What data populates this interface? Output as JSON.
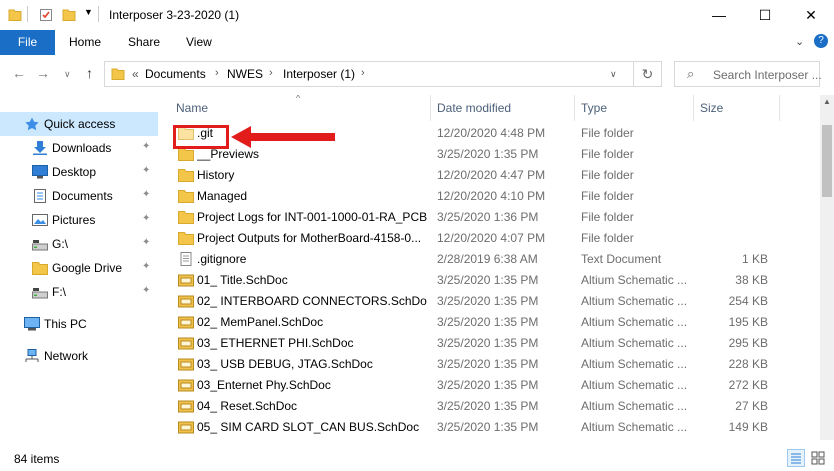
{
  "window": {
    "title": "Interposer 3-23-2020 (1)",
    "controls": {
      "minimize": "—",
      "maximize": "☐",
      "close": "✕"
    }
  },
  "ribbon": {
    "tabs": [
      "File",
      "Home",
      "Share",
      "View"
    ],
    "expand": "⌄",
    "help": "?"
  },
  "address": {
    "overflow": "«",
    "crumbs": [
      "Documents",
      "NWES",
      "Interposer (1)"
    ],
    "separator": "›",
    "refresh": "↻"
  },
  "search": {
    "placeholder": "Search Interposer ..."
  },
  "nav": {
    "items": [
      {
        "label": "Quick access",
        "icon": "star-icon",
        "pinned": false,
        "selected": true
      },
      {
        "label": "Downloads",
        "icon": "download-icon",
        "pinned": true
      },
      {
        "label": "Desktop",
        "icon": "desktop-icon",
        "pinned": true
      },
      {
        "label": "Documents",
        "icon": "documents-icon",
        "pinned": true
      },
      {
        "label": "Pictures",
        "icon": "pictures-icon",
        "pinned": true
      },
      {
        "label": "G:\\",
        "icon": "drive-icon",
        "pinned": true
      },
      {
        "label": "Google Drive",
        "icon": "folder-icon",
        "pinned": true
      },
      {
        "label": "F:\\",
        "icon": "drive-icon",
        "pinned": true
      },
      {
        "label": "This PC",
        "icon": "pc-icon",
        "pinned": false
      },
      {
        "label": "Network",
        "icon": "network-icon",
        "pinned": false
      }
    ],
    "pin_glyph": "📌"
  },
  "list": {
    "columns": {
      "name": "Name",
      "date": "Date modified",
      "type": "Type",
      "size": "Size"
    },
    "sort_indicator": "^",
    "files": [
      {
        "name": ".git",
        "date": "12/20/2020 4:48 PM",
        "type": "File folder",
        "size": "",
        "kind": "folder-light"
      },
      {
        "name": "__Previews",
        "date": "3/25/2020 1:35 PM",
        "type": "File folder",
        "size": "",
        "kind": "folder"
      },
      {
        "name": "History",
        "date": "12/20/2020 4:47 PM",
        "type": "File folder",
        "size": "",
        "kind": "folder"
      },
      {
        "name": "Managed",
        "date": "12/20/2020 4:10 PM",
        "type": "File folder",
        "size": "",
        "kind": "folder"
      },
      {
        "name": "Project Logs for INT-001-1000-01-RA_PCB",
        "date": "3/25/2020 1:36 PM",
        "type": "File folder",
        "size": "",
        "kind": "folder"
      },
      {
        "name": "Project Outputs for MotherBoard-4158-0...",
        "date": "12/20/2020 4:07 PM",
        "type": "File folder",
        "size": "",
        "kind": "folder"
      },
      {
        "name": ".gitignore",
        "date": "2/28/2019 6:38 AM",
        "type": "Text Document",
        "size": "1 KB",
        "kind": "text"
      },
      {
        "name": "01_ Title.SchDoc",
        "date": "3/25/2020 1:35 PM",
        "type": "Altium Schematic ...",
        "size": "38 KB",
        "kind": "schdoc"
      },
      {
        "name": "02_ INTERBOARD CONNECTORS.SchDoc",
        "date": "3/25/2020 1:35 PM",
        "type": "Altium Schematic ...",
        "size": "254 KB",
        "kind": "schdoc"
      },
      {
        "name": "02_ MemPanel.SchDoc",
        "date": "3/25/2020 1:35 PM",
        "type": "Altium Schematic ...",
        "size": "195 KB",
        "kind": "schdoc"
      },
      {
        "name": "03_ ETHERNET PHI.SchDoc",
        "date": "3/25/2020 1:35 PM",
        "type": "Altium Schematic ...",
        "size": "295 KB",
        "kind": "schdoc"
      },
      {
        "name": "03_ USB DEBUG, JTAG.SchDoc",
        "date": "3/25/2020 1:35 PM",
        "type": "Altium Schematic ...",
        "size": "228 KB",
        "kind": "schdoc"
      },
      {
        "name": "03_Enternet Phy.SchDoc",
        "date": "3/25/2020 1:35 PM",
        "type": "Altium Schematic ...",
        "size": "272 KB",
        "kind": "schdoc"
      },
      {
        "name": "04_ Reset.SchDoc",
        "date": "3/25/2020 1:35 PM",
        "type": "Altium Schematic ...",
        "size": "27 KB",
        "kind": "schdoc"
      },
      {
        "name": "05_ SIM CARD SLOT_CAN BUS.SchDoc",
        "date": "3/25/2020 1:35 PM",
        "type": "Altium Schematic ...",
        "size": "149 KB",
        "kind": "schdoc"
      }
    ]
  },
  "status": {
    "item_count": "84 items"
  },
  "colors": {
    "accent": "#1a6ec6",
    "selection": "#cce8ff",
    "annotation": "#e21b1b",
    "folder": "#f3c548"
  }
}
